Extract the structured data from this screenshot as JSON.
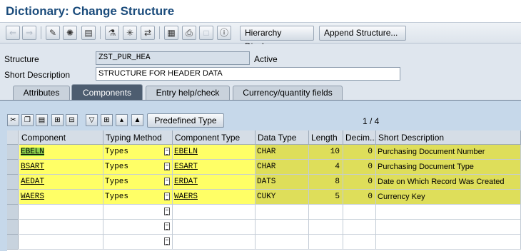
{
  "window": {
    "title": "Dictionary: Change Structure"
  },
  "toolbar": {
    "icons": [
      "back-icon",
      "forward-icon",
      "display-change-icon",
      "active-inactive-icon",
      "other-object-icon",
      "check-icon",
      "activate-icon",
      "where-used-icon",
      "object-list-icon",
      "print-icon",
      "info-icon"
    ],
    "hierarchy_label": "Hierarchy Display",
    "append_label": "Append Structure..."
  },
  "header": {
    "structure_label": "Structure",
    "structure_value": "ZST_PUR_HEA",
    "status": "Active",
    "shortdesc_label": "Short Description",
    "shortdesc_value": "STRUCTURE FOR HEADER DATA"
  },
  "tabs": [
    "Attributes",
    "Components",
    "Entry help/check",
    "Currency/quantity fields"
  ],
  "active_tab": "Components",
  "grid_toolbar": {
    "predefined_label": "Predefined Type",
    "pager": "1  /  4"
  },
  "columns": [
    "Component",
    "Typing Method",
    "Component Type",
    "Data Type",
    "Length",
    "Decim...",
    "Short Description"
  ],
  "rows": [
    {
      "component": "EBELN",
      "typing": "Types",
      "comptype": "EBELN",
      "datatype": "CHAR",
      "length": "10",
      "decimals": "0",
      "desc": "Purchasing Document Number"
    },
    {
      "component": "BSART",
      "typing": "Types",
      "comptype": "ESART",
      "datatype": "CHAR",
      "length": "4",
      "decimals": "0",
      "desc": "Purchasing Document Type"
    },
    {
      "component": "AEDAT",
      "typing": "Types",
      "comptype": "ERDAT",
      "datatype": "DATS",
      "length": "8",
      "decimals": "0",
      "desc": "Date on Which Record Was Created"
    },
    {
      "component": "WAERS",
      "typing": "Types",
      "comptype": "WAERS",
      "datatype": "CUKY",
      "length": "5",
      "decimals": "0",
      "desc": "Currency Key"
    }
  ],
  "colors": {
    "highlight": "#ffff66",
    "title": "#1b4c7c",
    "panel": "#c6d8ea",
    "active_tab": "#4d5d70"
  }
}
